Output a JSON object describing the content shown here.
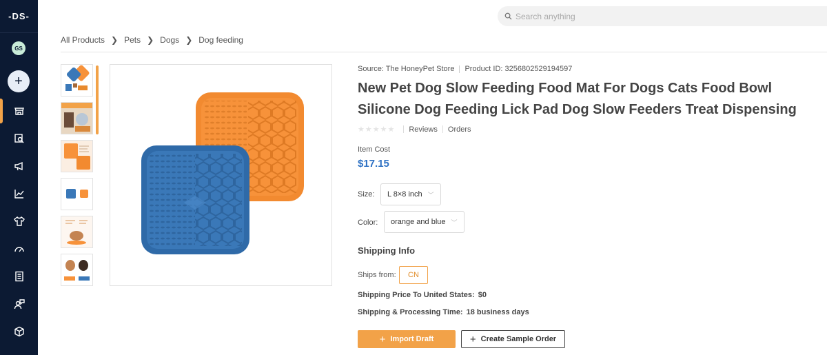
{
  "sidebar": {
    "logo": "-DS-",
    "avatar_initials": "GS",
    "add_label": "+",
    "items": [
      {
        "icon": "store-icon",
        "active": true
      },
      {
        "icon": "product-search-icon",
        "active": false
      },
      {
        "icon": "megaphone-icon",
        "active": false
      },
      {
        "icon": "analytics-icon",
        "active": false
      },
      {
        "icon": "tshirt-icon",
        "active": false
      },
      {
        "icon": "gauge-icon",
        "active": false
      },
      {
        "icon": "document-icon",
        "active": false
      },
      {
        "icon": "user-chat-icon",
        "active": false
      },
      {
        "icon": "box-icon",
        "active": false
      }
    ]
  },
  "search": {
    "placeholder": "Search anything"
  },
  "breadcrumb": [
    "All Products",
    "Pets",
    "Dogs",
    "Dog feeding"
  ],
  "product": {
    "source": "Source: The HoneyPet Store",
    "product_id": "Product ID: 3256802529194597",
    "title": "New Pet Dog Slow Feeding Food Mat For Dogs Cats Food Bowl Silicone Dog Feeding Lick Pad Dog Slow Feeders Treat Dispensing",
    "reviews_label": "Reviews",
    "orders_label": "Orders",
    "item_cost_label": "Item Cost",
    "item_cost": "$17.15",
    "size_label": "Size:",
    "size_value": "L 8×8 inch",
    "color_label": "Color:",
    "color_value": "orange and blue"
  },
  "shipping": {
    "heading": "Shipping Info",
    "ships_from_label": "Ships from:",
    "ships_from_value": "CN",
    "price_label": "Shipping Price To United States:",
    "price_value": "$0",
    "time_label": "Shipping & Processing Time:",
    "time_value": "18 business days"
  },
  "actions": {
    "import_label": "Import Draft",
    "sample_label": "Create Sample Order"
  },
  "colors": {
    "accent": "#f2a248",
    "sidebar_bg": "#0c1a33",
    "price": "#2f72c4",
    "mat_orange": "#f7923a",
    "mat_blue": "#3a78b8"
  }
}
